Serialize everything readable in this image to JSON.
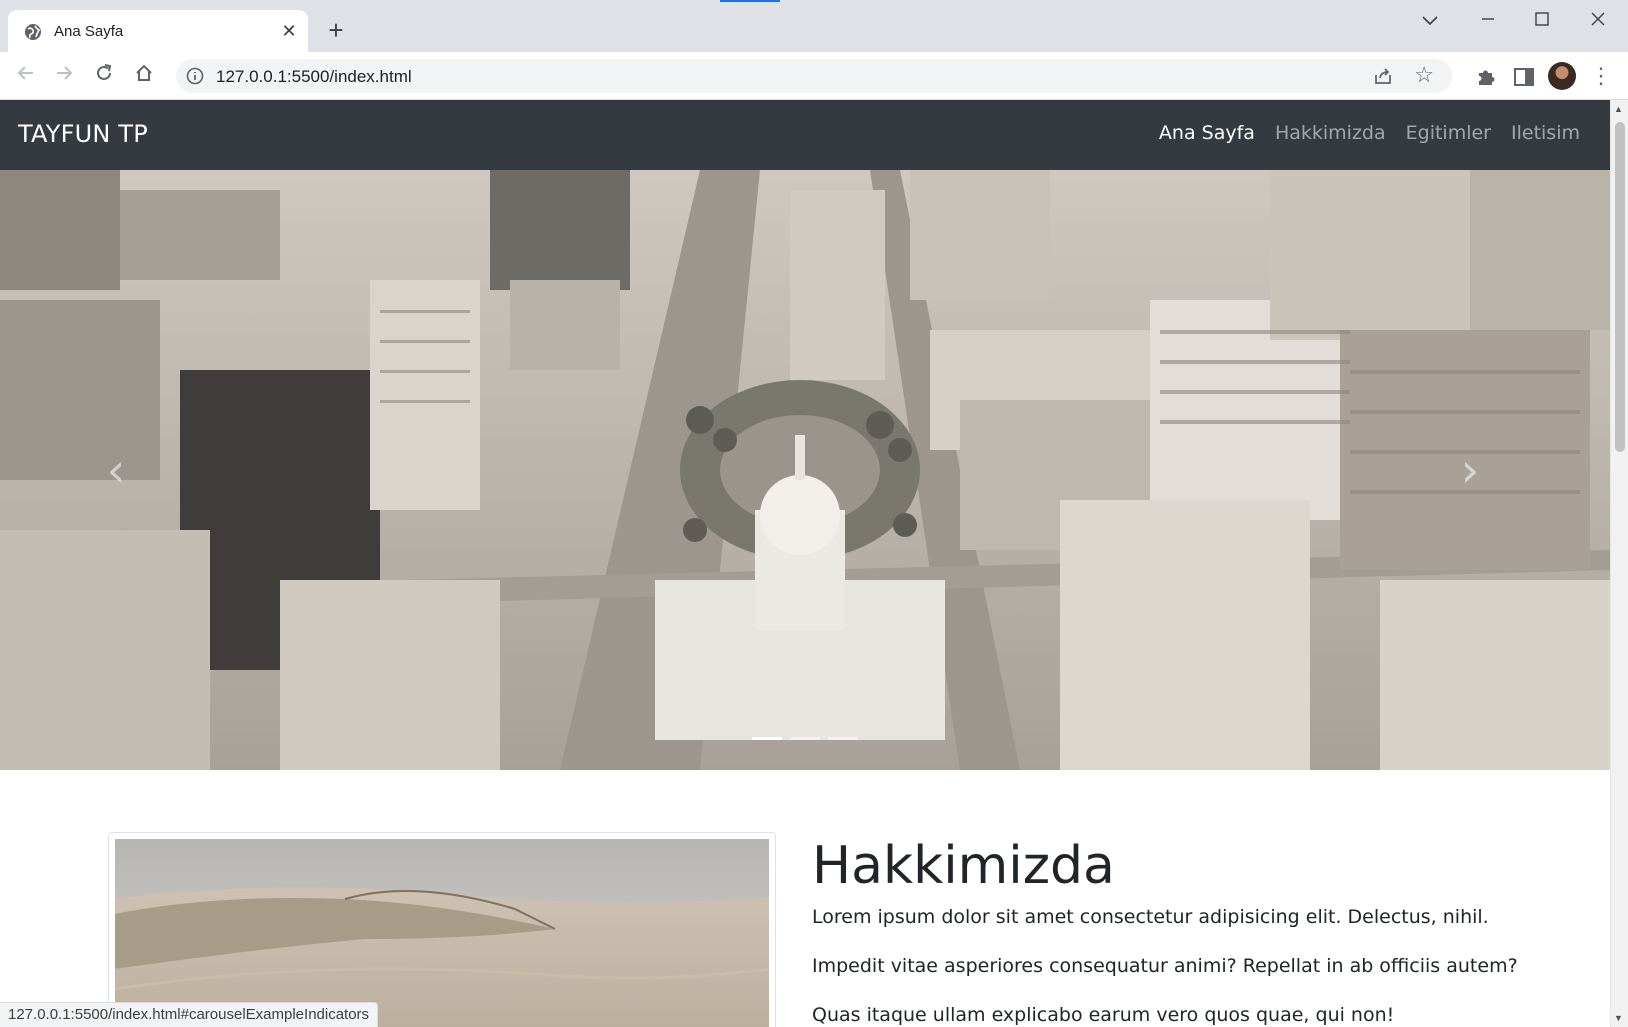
{
  "browser": {
    "tab_title": "Ana Sayfa",
    "url": "127.0.0.1:5500/index.html",
    "new_tab_symbol": "+",
    "close_tab_symbol": "✕"
  },
  "site": {
    "brand": "TAYFUN TP",
    "nav": [
      {
        "label": "Ana Sayfa",
        "active": true
      },
      {
        "label": "Hakkimizda",
        "active": false
      },
      {
        "label": "Egitimler",
        "active": false
      },
      {
        "label": "Iletisim",
        "active": false
      }
    ],
    "carousel": {
      "prev_symbol": "‹",
      "next_symbol": "›",
      "slide_count": 3,
      "active_index": 0
    }
  },
  "about": {
    "heading": "Hakkimizda",
    "paragraphs": [
      "Lorem ipsum dolor sit amet consectetur adipisicing elit. Delectus, nihil.",
      "Impedit vitae asperiores consequatur animi? Repellat in ab officiis autem?",
      "Quas itaque ullam explicabo earum vero quos quae, qui non!"
    ]
  },
  "status_url": "127.0.0.1:5500/index.html#carouselExampleIndicators",
  "icons": {
    "tab": "globe-icon",
    "back": "back-arrow-icon",
    "forward": "forward-arrow-icon",
    "reload": "reload-icon",
    "home": "home-icon",
    "site_info": "info-icon",
    "share": "share-icon",
    "bookmark": "star-icon",
    "extensions": "puzzle-icon",
    "side_panel": "side-panel-icon",
    "menu": "kebab-menu-icon"
  },
  "colors": {
    "navbar": "#343a40",
    "tab_strip": "#dee1e6",
    "nav_active": "#ffffff",
    "nav_inactive": "rgba(255,255,255,0.55)"
  }
}
